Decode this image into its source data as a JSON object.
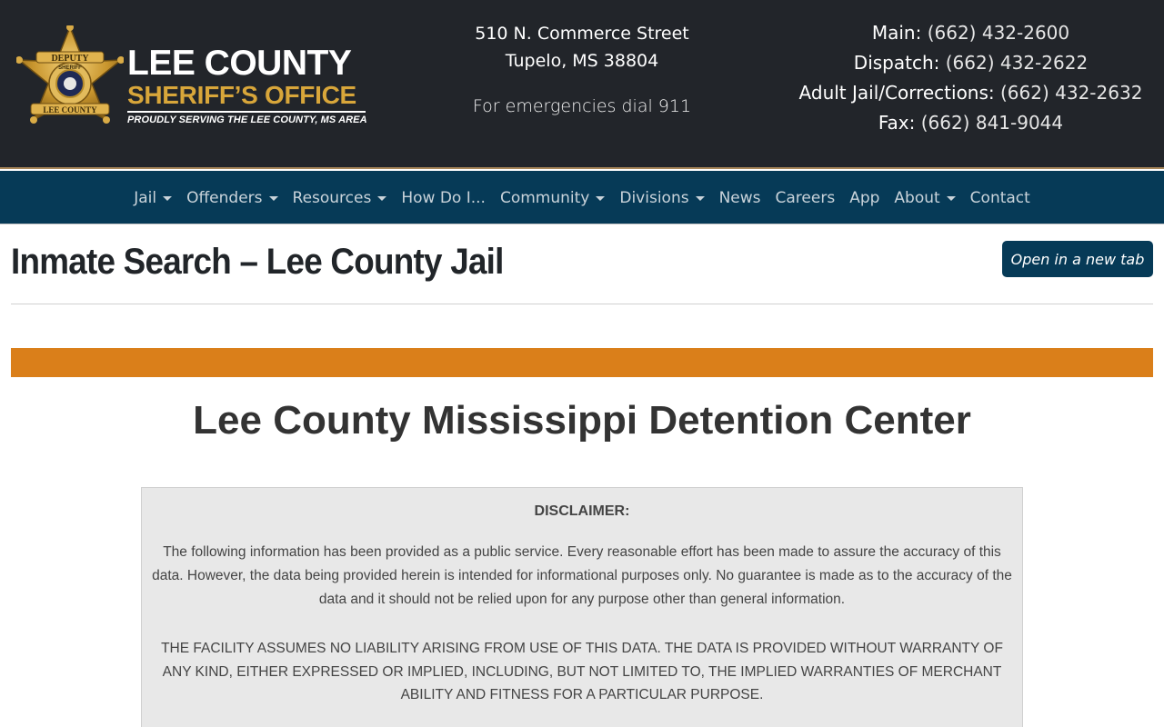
{
  "header": {
    "brand": {
      "line1": "LEE COUNTY",
      "line2": "SHERIFF’S OFFICE",
      "tagline": "PROUDLY SERVING THE LEE COUNTY, MS AREA",
      "badge_top": "DEPUTY",
      "badge_inner": "SHERIFF",
      "badge_bottom": "LEE COUNTY"
    },
    "address": {
      "street": "510 N. Commerce Street",
      "city": "Tupelo, MS 38804",
      "emergency": "For emergencies dial 911"
    },
    "phones": [
      {
        "label": "Main:",
        "number": "(662) 432-2600"
      },
      {
        "label": "Dispatch:",
        "number": "(662) 432-2622"
      },
      {
        "label": "Adult Jail/Corrections:",
        "number": "(662) 432-2632"
      },
      {
        "label": "Fax:",
        "number": "(662) 841-9044"
      }
    ]
  },
  "nav": {
    "items": [
      {
        "label": "Jail",
        "dropdown": true
      },
      {
        "label": "Offenders",
        "dropdown": true
      },
      {
        "label": "Resources",
        "dropdown": true
      },
      {
        "label": "How Do I...",
        "dropdown": false
      },
      {
        "label": "Community",
        "dropdown": true
      },
      {
        "label": "Divisions",
        "dropdown": true
      },
      {
        "label": "News",
        "dropdown": false
      },
      {
        "label": "Careers",
        "dropdown": false
      },
      {
        "label": "App",
        "dropdown": false
      },
      {
        "label": "About",
        "dropdown": true
      },
      {
        "label": "Contact",
        "dropdown": false
      }
    ]
  },
  "main": {
    "page_title": "Inmate Search – Lee County Jail",
    "open_new_tab": "Open in a new tab",
    "embed_title": "Lee County Mississippi Detention Center",
    "disclaimer": {
      "title": "DISCLAIMER:",
      "paragraph1": "The following information has been provided as a public service. Every reasonable effort has been made to assure the accuracy of this data. However, the data being provided herein is intended for informational purposes only. No guarantee is made as to the accuracy of the data and it should not be relied upon for any purpose other than general information.",
      "paragraph2": "THE FACILITY ASSUMES NO LIABILITY ARISING FROM USE OF THIS DATA. THE DATA IS PROVIDED WITHOUT WARRANTY OF ANY KIND, EITHER EXPRESSED OR IMPLIED, INCLUDING, BUT NOT LIMITED TO, THE IMPLIED WARRANTIES OF MERCHANT ABILITY AND FITNESS FOR A PARTICULAR PURPOSE."
    }
  },
  "colors": {
    "header_bg": "#22252a",
    "nav_bg": "#063a57",
    "brand_gold": "#d8a63a",
    "accent_orange": "#da7f1a",
    "disclaimer_bg": "#e8e8e8"
  },
  "icons": {
    "badge": "sheriff-star-badge-icon",
    "dropdown": "caret-down-icon"
  }
}
